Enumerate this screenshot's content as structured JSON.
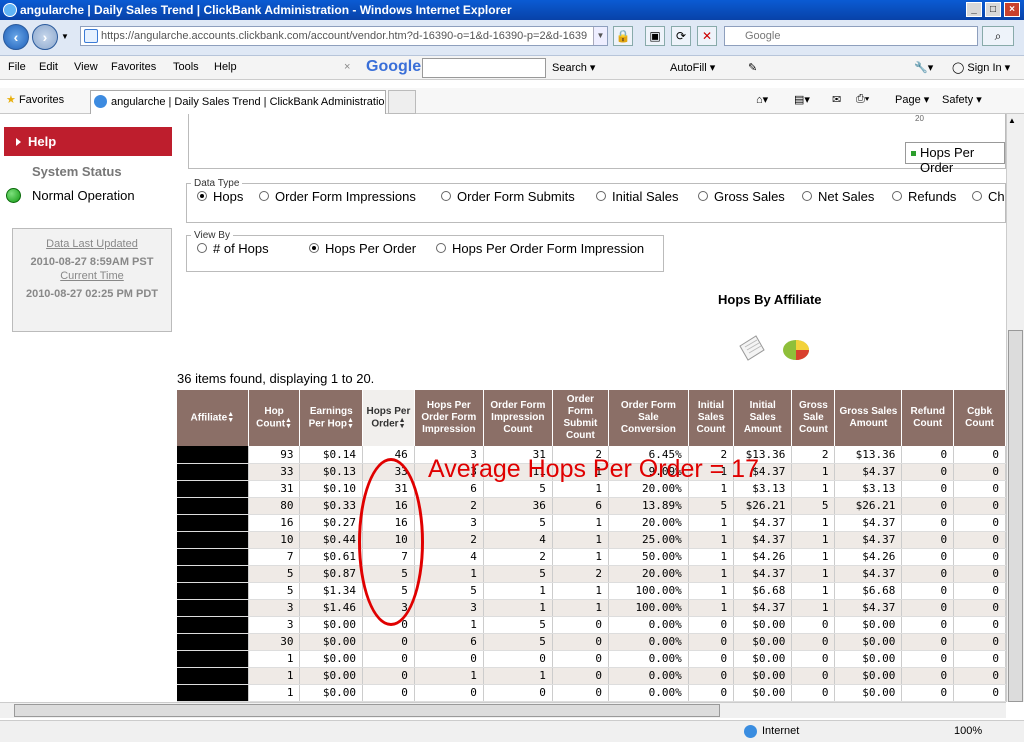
{
  "window": {
    "title": "angularche | Daily Sales Trend | ClickBank Administration - Windows Internet Explorer"
  },
  "address": {
    "url": "https://angularche.accounts.clickbank.com/account/vendor.htm?d-16390-o=1&d-16390-p=2&d-1639"
  },
  "search_box": {
    "placeholder": "Google"
  },
  "menu": {
    "file": "File",
    "edit": "Edit",
    "view": "View",
    "favorites": "Favorites",
    "tools": "Tools",
    "help": "Help"
  },
  "google_toolbar": {
    "logo": "Google",
    "search_label": "Search",
    "autofill": "AutoFill",
    "sign_in": "Sign In"
  },
  "favbar": {
    "favorites": "Favorites",
    "tab_title": "angularche | Daily Sales Trend | ClickBank Administration",
    "page": "Page",
    "safety": "Safety"
  },
  "sidebar": {
    "help": "Help",
    "system_status": "System Status",
    "normal_operation": "Normal Operation",
    "data_last_updated_label": "Data Last Updated",
    "data_last_updated_value": "2010-08-27 8:59AM PST",
    "current_time_label": "Current Time",
    "current_time_value": "2010-08-27 02:25 PM PDT"
  },
  "chart": {
    "legend_item": "Hops Per Order",
    "axis_fragment": "20"
  },
  "data_type": {
    "legend": "Data Type",
    "options": [
      "Hops",
      "Order Form Impressions",
      "Order Form Submits",
      "Initial Sales",
      "Gross Sales",
      "Net Sales",
      "Refunds",
      "Ch"
    ],
    "selected": "Hops"
  },
  "view_by": {
    "legend": "View By",
    "options": [
      "# of Hops",
      "Hops Per Order",
      "Hops Per Order Form Impression"
    ],
    "selected": "Hops Per Order"
  },
  "hops_by_affiliate": "Hops By Affiliate",
  "items_found": "36 items found, displaying 1 to 20.",
  "table": {
    "headers": [
      "Affiliate",
      "Hop Count",
      "Earnings Per Hop",
      "Hops Per Order",
      "Hops Per Order Form Impression",
      "Order Form Impression Count",
      "Order Form Submit Count",
      "Order Form Sale Conversion",
      "Initial Sales Count",
      "Initial Sales Amount",
      "Gross Sale Count",
      "Gross Sales Amount",
      "Refund Count",
      "Cgbk Count"
    ],
    "rows": [
      [
        "",
        "93",
        "$0.14",
        "46",
        "3",
        "31",
        "2",
        "6.45%",
        "2",
        "$13.36",
        "2",
        "$13.36",
        "0",
        "0"
      ],
      [
        "",
        "33",
        "$0.13",
        "33",
        "3",
        "11",
        "1",
        "9.09%",
        "1",
        "$4.37",
        "1",
        "$4.37",
        "0",
        "0"
      ],
      [
        "",
        "31",
        "$0.10",
        "31",
        "6",
        "5",
        "1",
        "20.00%",
        "1",
        "$3.13",
        "1",
        "$3.13",
        "0",
        "0"
      ],
      [
        "",
        "80",
        "$0.33",
        "16",
        "2",
        "36",
        "6",
        "13.89%",
        "5",
        "$26.21",
        "5",
        "$26.21",
        "0",
        "0"
      ],
      [
        "",
        "16",
        "$0.27",
        "16",
        "3",
        "5",
        "1",
        "20.00%",
        "1",
        "$4.37",
        "1",
        "$4.37",
        "0",
        "0"
      ],
      [
        "",
        "10",
        "$0.44",
        "10",
        "2",
        "4",
        "1",
        "25.00%",
        "1",
        "$4.37",
        "1",
        "$4.37",
        "0",
        "0"
      ],
      [
        "",
        "7",
        "$0.61",
        "7",
        "4",
        "2",
        "1",
        "50.00%",
        "1",
        "$4.26",
        "1",
        "$4.26",
        "0",
        "0"
      ],
      [
        "",
        "5",
        "$0.87",
        "5",
        "1",
        "5",
        "2",
        "20.00%",
        "1",
        "$4.37",
        "1",
        "$4.37",
        "0",
        "0"
      ],
      [
        "",
        "5",
        "$1.34",
        "5",
        "5",
        "1",
        "1",
        "100.00%",
        "1",
        "$6.68",
        "1",
        "$6.68",
        "0",
        "0"
      ],
      [
        "",
        "3",
        "$1.46",
        "3",
        "3",
        "1",
        "1",
        "100.00%",
        "1",
        "$4.37",
        "1",
        "$4.37",
        "0",
        "0"
      ],
      [
        "",
        "3",
        "$0.00",
        "0",
        "1",
        "5",
        "0",
        "0.00%",
        "0",
        "$0.00",
        "0",
        "$0.00",
        "0",
        "0"
      ],
      [
        "",
        "30",
        "$0.00",
        "0",
        "6",
        "5",
        "0",
        "0.00%",
        "0",
        "$0.00",
        "0",
        "$0.00",
        "0",
        "0"
      ],
      [
        "",
        "1",
        "$0.00",
        "0",
        "0",
        "0",
        "0",
        "0.00%",
        "0",
        "$0.00",
        "0",
        "$0.00",
        "0",
        "0"
      ],
      [
        "",
        "1",
        "$0.00",
        "0",
        "1",
        "1",
        "0",
        "0.00%",
        "0",
        "$0.00",
        "0",
        "$0.00",
        "0",
        "0"
      ],
      [
        "",
        "1",
        "$0.00",
        "0",
        "0",
        "0",
        "0",
        "0.00%",
        "0",
        "$0.00",
        "0",
        "$0.00",
        "0",
        "0"
      ]
    ]
  },
  "annotation": "Average Hops Per Order = 17",
  "status": {
    "zone": "Internet",
    "zoom": "100%"
  },
  "colors": {
    "accent": "#be1e2d",
    "table_header": "#8b6f67",
    "annotation": "#e00000"
  }
}
